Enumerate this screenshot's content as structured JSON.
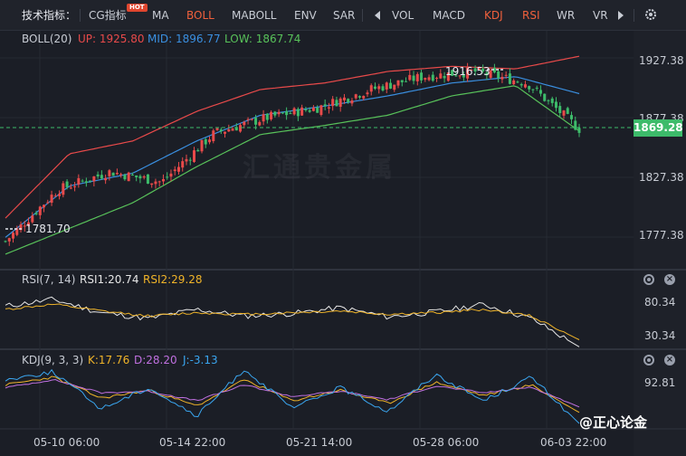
{
  "toolbar": {
    "label": "技术指标：",
    "tabs": [
      "CG指标",
      "MA",
      "BOLL",
      "MABOLL",
      "ENV",
      "SAR"
    ],
    "hot_badge": "HOT",
    "tabs2": [
      "VOL",
      "MACD",
      "KDJ",
      "RSI",
      "WR",
      "VR"
    ],
    "active": [
      "BOLL",
      "KDJ",
      "RSI"
    ],
    "prev_icon": "chevron-left-icon",
    "next_icon": "chevron-right-icon",
    "settings_icon": "gear-icon"
  },
  "boll": {
    "name": "BOLL(20)",
    "up": "UP: 1925.80",
    "mid": "MID: 1896.77",
    "low": "LOW: 1867.74",
    "axis": [
      "1927.38",
      "1877.38",
      "1827.38",
      "1777.38"
    ],
    "current_price": "1869.28",
    "high_label": "1916.53",
    "low_label": "1781.70",
    "watermark": "汇通贵金属"
  },
  "rsi": {
    "name": "RSI(7, 14)",
    "rsi1": "RSI1:20.74",
    "rsi2": "RSI2:29.28",
    "axis": [
      "80.34",
      "30.34"
    ]
  },
  "kdj": {
    "name": "KDJ(9, 3, 3)",
    "k": "K:17.76",
    "d": "D:28.20",
    "j": "J:-3.13",
    "axis": [
      "92.81"
    ]
  },
  "time_axis": [
    "05-10 06:00",
    "05-14 22:00",
    "05-21 14:00",
    "05-28 06:00",
    "06-03 22:00"
  ],
  "brand": "@正心论金",
  "colors": {
    "up": "#e84a4a",
    "down": "#3dbb6a",
    "mid": "#3a8fe0",
    "low": "#58c25a",
    "rsi1": "#e6e6e6",
    "rsi2": "#f0b429",
    "k": "#f0b429",
    "d": "#c070e0",
    "j": "#3aa6f0",
    "active_tab": "#f0603c"
  },
  "chart_data": [
    {
      "type": "candlestick",
      "title": "BOLL(20)",
      "x": [
        "05-10 06:00",
        "05-14 22:00",
        "05-21 14:00",
        "05-28 06:00",
        "06-03 22:00"
      ],
      "ylim": [
        1760,
        1940
      ],
      "series": [
        {
          "name": "UP",
          "values": [
            1800,
            1850,
            1860,
            1883,
            1900,
            1905,
            1914,
            1918,
            1916,
            1925.8
          ]
        },
        {
          "name": "MID",
          "values": [
            1785,
            1825,
            1835,
            1860,
            1880,
            1887,
            1895,
            1905,
            1910,
            1896.77
          ]
        },
        {
          "name": "LOW",
          "values": [
            1772,
            1792,
            1812,
            1840,
            1865,
            1872,
            1880,
            1895,
            1903,
            1867.74
          ]
        }
      ],
      "close": [
        1782,
        1822,
        1836,
        1828,
        1866,
        1878,
        1886,
        1900,
        1910,
        1914,
        1905,
        1869.28
      ],
      "annotations": [
        "1916.53",
        "1781.70"
      ]
    },
    {
      "type": "line",
      "title": "RSI(7, 14)",
      "ylim": [
        20,
        90
      ],
      "series": [
        {
          "name": "RSI1",
          "values": [
            70,
            78,
            62,
            55,
            66,
            58,
            61,
            68,
            57,
            63,
            72,
            55,
            20.74
          ]
        },
        {
          "name": "RSI2",
          "values": [
            66,
            72,
            64,
            58,
            62,
            60,
            62,
            64,
            60,
            62,
            66,
            58,
            29.28
          ]
        }
      ]
    },
    {
      "type": "line",
      "title": "KDJ(9, 3, 3)",
      "ylim": [
        -10,
        100
      ],
      "series": [
        {
          "name": "K",
          "values": [
            70,
            85,
            45,
            60,
            30,
            80,
            40,
            60,
            35,
            75,
            50,
            70,
            17.76
          ]
        },
        {
          "name": "D",
          "values": [
            65,
            80,
            55,
            58,
            40,
            70,
            48,
            58,
            42,
            68,
            55,
            66,
            28.2
          ]
        },
        {
          "name": "J",
          "values": [
            80,
            95,
            25,
            65,
            10,
            100,
            25,
            65,
            20,
            90,
            40,
            85,
            -3.13
          ]
        }
      ]
    }
  ]
}
